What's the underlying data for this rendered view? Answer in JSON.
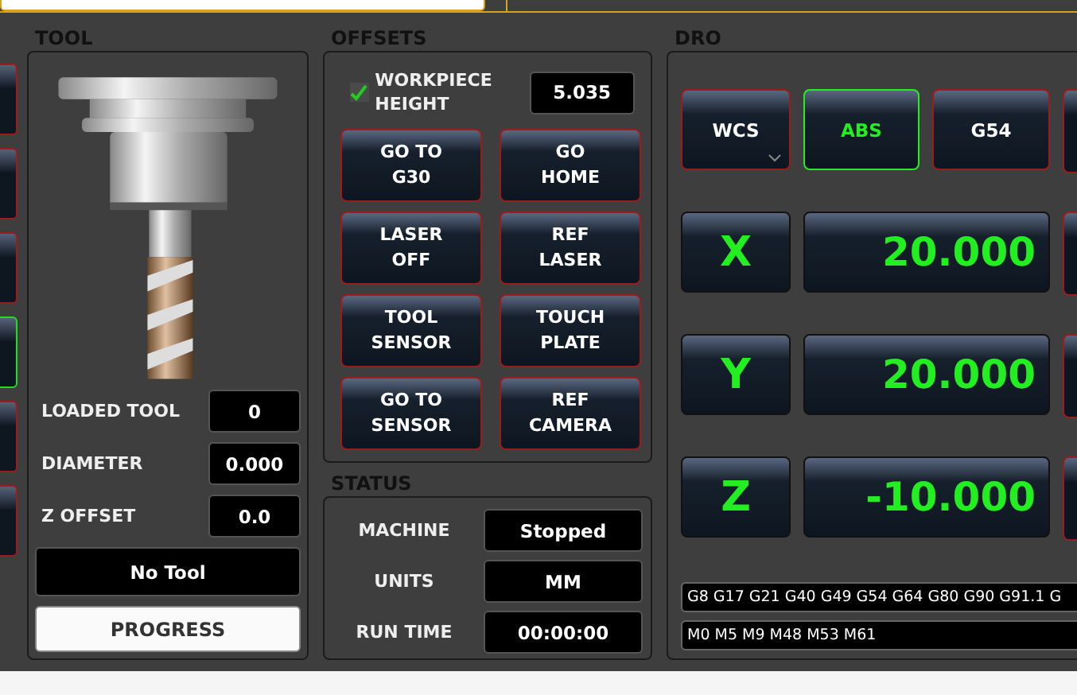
{
  "left_strip": [
    {
      "selected": false
    },
    {
      "selected": false
    },
    {
      "selected": false
    },
    {
      "selected": true
    },
    {
      "selected": false
    },
    {
      "selected": false
    }
  ],
  "tool": {
    "title": "TOOL",
    "fields": [
      {
        "label": "LOADED TOOL",
        "value": "0"
      },
      {
        "label": "DIAMETER",
        "value": "0.000"
      },
      {
        "label": "Z OFFSET",
        "value": "0.0"
      }
    ],
    "tool_name": "No Tool",
    "progress_button": "PROGRESS"
  },
  "offsets": {
    "title": "OFFSETS",
    "workpiece": {
      "label": "WORKPIECE HEIGHT",
      "checked": true,
      "value": "5.035"
    },
    "buttons": [
      {
        "label": "GO TO G30"
      },
      {
        "label": "GO HOME"
      },
      {
        "label": "LASER OFF"
      },
      {
        "label": "REF LASER"
      },
      {
        "label": "TOOL SENSOR"
      },
      {
        "label": "TOUCH PLATE"
      },
      {
        "label": "GO TO SENSOR"
      },
      {
        "label": "REF CAMERA"
      }
    ]
  },
  "status": {
    "title": "STATUS",
    "rows": [
      {
        "label": "MACHINE",
        "value": "Stopped"
      },
      {
        "label": "UNITS",
        "value": "MM"
      },
      {
        "label": "RUN TIME",
        "value": "00:00:00"
      }
    ]
  },
  "dro": {
    "title": "DRO",
    "mode_buttons": [
      {
        "label": "WCS",
        "kind": "dropdown",
        "selected": false
      },
      {
        "label": "ABS",
        "kind": "toggle",
        "selected": true
      },
      {
        "label": "G54",
        "kind": "toggle",
        "selected": false
      }
    ],
    "axes": [
      {
        "axis": "X",
        "value": "20.000"
      },
      {
        "axis": "Y",
        "value": "20.000"
      },
      {
        "axis": "Z",
        "value": "-10.000"
      }
    ],
    "gcodes": "G8 G17 G21 G40 G49 G54 G64 G80 G90 G91.1 G",
    "mcodes": "M0 M5 M9 M48 M53 M61"
  }
}
